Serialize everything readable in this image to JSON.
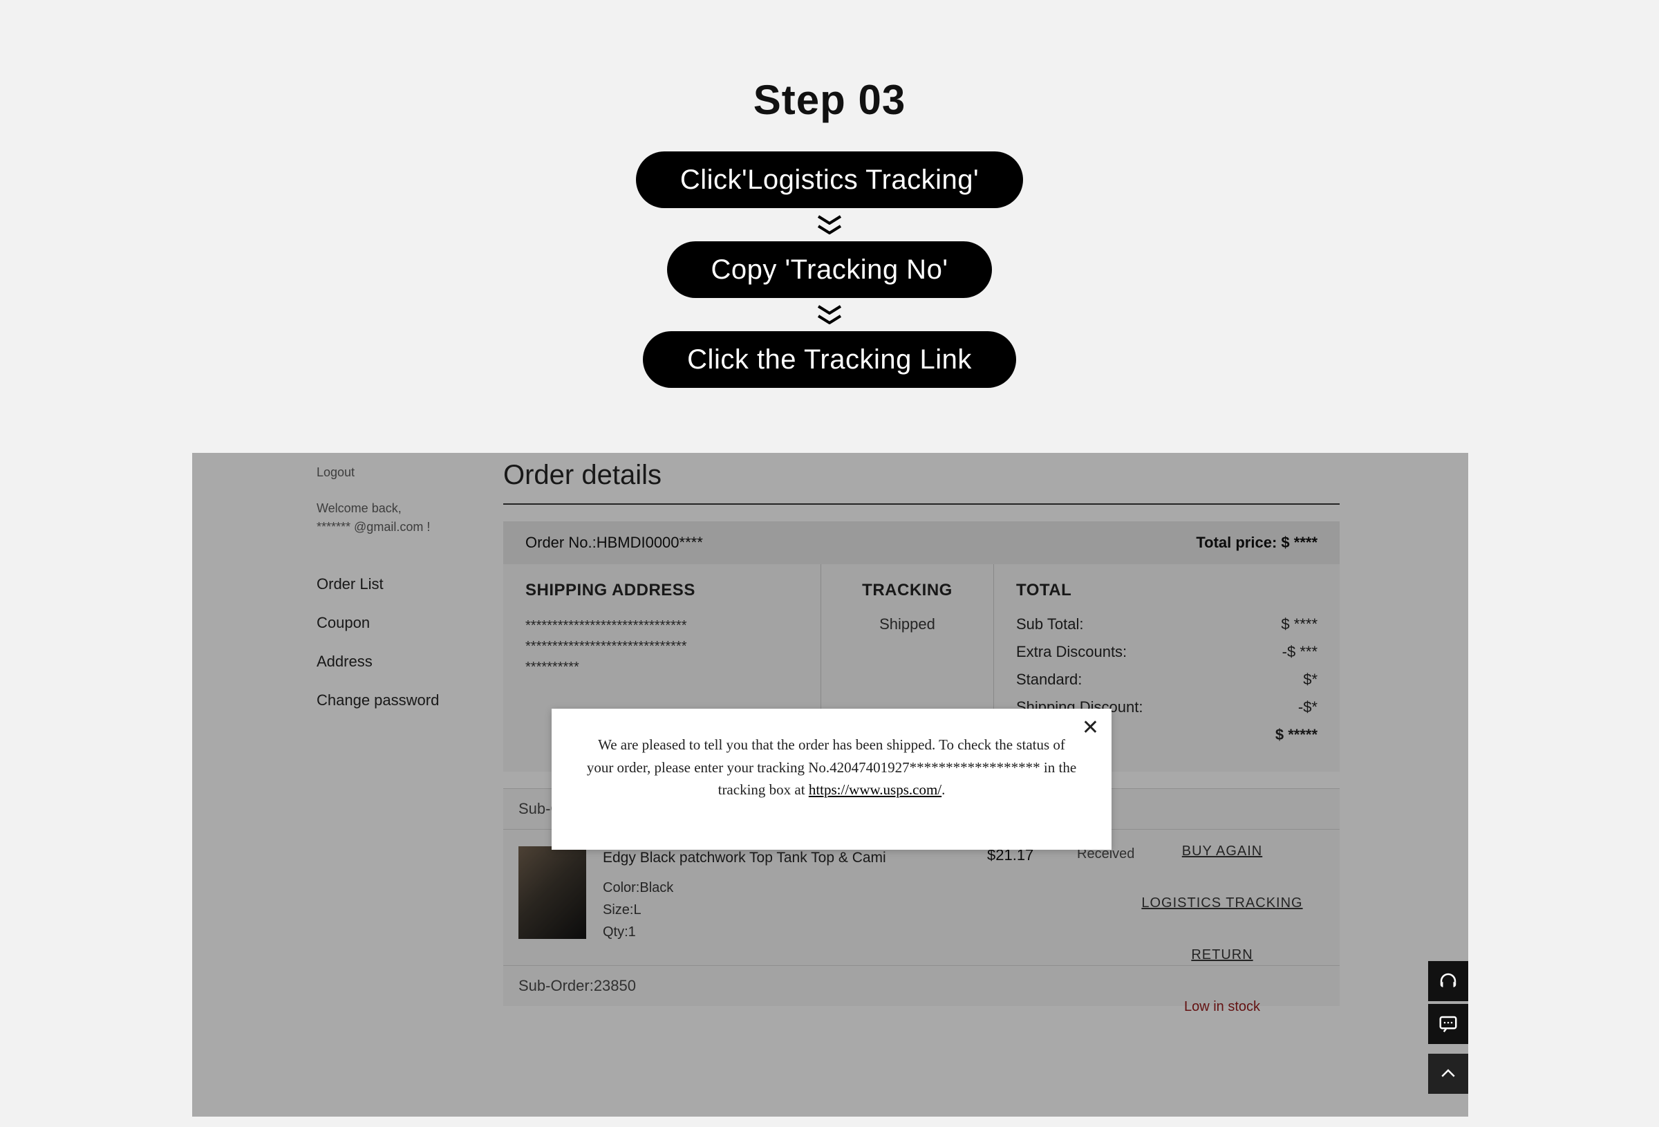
{
  "step_title": "Step 03",
  "pills": [
    "Click'Logistics Tracking'",
    "Copy 'Tracking No'",
    "Click the Tracking Link"
  ],
  "sidebar": {
    "logout": "Logout",
    "welcome": "Welcome back,",
    "email": "******* @gmail.com !",
    "items": [
      "Order List",
      "Coupon",
      "Address",
      "Change password"
    ]
  },
  "order": {
    "title": "Order details",
    "number_label": "Order No.:",
    "number": "HBMDI0000****",
    "total_price_label": "Total price:",
    "total_price": "$ ****"
  },
  "columns": {
    "ship_hdr": "SHIPPING ADDRESS",
    "track_hdr": "TRACKING",
    "total_hdr": "TOTAL",
    "addr_line1": "******************************",
    "addr_line2": "******************************",
    "addr_line3": "**********",
    "track_status": "Shipped"
  },
  "totals": {
    "sub_label": "Sub Total:",
    "sub_val": "$  ****",
    "extra_label": "Extra Discounts:",
    "extra_val": "-$  ***",
    "std_label": "Standard:",
    "std_val": "$*",
    "ship_label": "Shipping Discount:",
    "ship_val": "-$*",
    "final_val": "$ *****"
  },
  "modal": {
    "text_a": "We are pleased to tell you that the order has been shipped. To check the status of your order, please enter your tracking No.42047401927******************   in the tracking box at ",
    "link": "https://www.usps.com/",
    "text_b": "."
  },
  "suborder1_label": "Sub-O",
  "item": {
    "name": "Edgy Black patchwork Top Tank Top & Cami",
    "color": "Color:Black",
    "size": "Size:L",
    "qty": "Qty:1",
    "price": "$21.17",
    "status": "Received"
  },
  "actions": {
    "buy": "BUY AGAIN",
    "track": "LOGISTICS TRACKING",
    "return": "RETURN",
    "low": "Low in stock"
  },
  "suborder2": "Sub-Order:23850"
}
